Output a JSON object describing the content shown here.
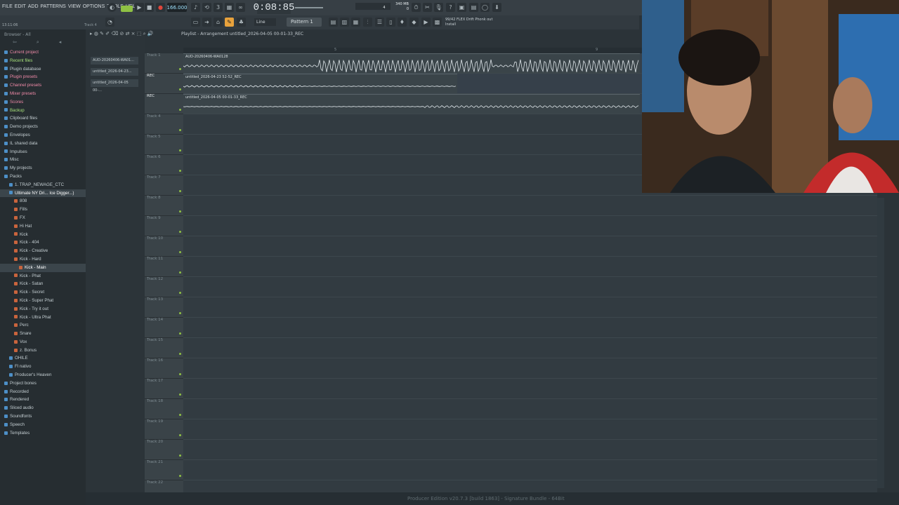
{
  "menu": [
    "FILE",
    "EDIT",
    "ADD",
    "PATTERNS",
    "VIEW",
    "OPTIONS",
    "TOOLS",
    "HELP"
  ],
  "transport": {
    "tempo": "166.000",
    "time": "0:08:85",
    "cpu_line1": "340 MB",
    "cpu_line2": "0",
    "num_a": "4"
  },
  "hint_left": "13:11:06",
  "hint_track": "Track 4",
  "toolbar2": {
    "snap": "Line",
    "pattern": "Pattern 1",
    "plugin_line1": "99/42  FLEX  Drift Phonk out",
    "plugin_line2": "Install"
  },
  "browser": {
    "header": "Browser - All",
    "items": [
      {
        "label": "Current project",
        "style": "pink",
        "indent": 1
      },
      {
        "label": "Recent files",
        "style": "green",
        "indent": 1
      },
      {
        "label": "Plugin database",
        "style": "",
        "indent": 1
      },
      {
        "label": "Plugin presets",
        "style": "pink",
        "indent": 1
      },
      {
        "label": "Channel presets",
        "style": "pink",
        "indent": 1
      },
      {
        "label": "Mixer presets",
        "style": "pink",
        "indent": 1
      },
      {
        "label": "Scores",
        "style": "pink",
        "indent": 1
      },
      {
        "label": "Backup",
        "style": "green",
        "indent": 1
      },
      {
        "label": "Clipboard files",
        "style": "",
        "indent": 1
      },
      {
        "label": "Demo projects",
        "style": "",
        "indent": 1
      },
      {
        "label": "Envelopes",
        "style": "",
        "indent": 1
      },
      {
        "label": "IL shared data",
        "style": "",
        "indent": 1
      },
      {
        "label": "Impulses",
        "style": "",
        "indent": 1
      },
      {
        "label": "Misc",
        "style": "",
        "indent": 1
      },
      {
        "label": "My projects",
        "style": "",
        "indent": 1
      },
      {
        "label": "Packs",
        "style": "",
        "indent": 1
      },
      {
        "label": "1. TRAP_NEWAGE_CTC",
        "style": "",
        "indent": 2
      },
      {
        "label": "Ultimate NY Dri... Ice Digger...)",
        "style": "sel",
        "indent": 2
      },
      {
        "label": "808",
        "style": "",
        "indent": 3
      },
      {
        "label": "Fills",
        "style": "",
        "indent": 3
      },
      {
        "label": "FX",
        "style": "",
        "indent": 3
      },
      {
        "label": "Hi Hat",
        "style": "",
        "indent": 3
      },
      {
        "label": "Kick",
        "style": "",
        "indent": 3
      },
      {
        "label": "Kick - 404",
        "style": "",
        "indent": 3
      },
      {
        "label": "Kick - Creative",
        "style": "",
        "indent": 3
      },
      {
        "label": "Kick - Hard",
        "style": "",
        "indent": 3
      },
      {
        "label": "Kick - Main",
        "style": "sel",
        "indent": 4
      },
      {
        "label": "Kick - Phat",
        "style": "",
        "indent": 3
      },
      {
        "label": "Kick - Satan",
        "style": "",
        "indent": 3
      },
      {
        "label": "Kick - Secret",
        "style": "",
        "indent": 3
      },
      {
        "label": "Kick - Super Phat",
        "style": "",
        "indent": 3
      },
      {
        "label": "Kick - Try it out",
        "style": "",
        "indent": 3
      },
      {
        "label": "Kick - Ultra Phat",
        "style": "",
        "indent": 3
      },
      {
        "label": "Perc",
        "style": "",
        "indent": 3
      },
      {
        "label": "Snare",
        "style": "",
        "indent": 3
      },
      {
        "label": "Vox",
        "style": "",
        "indent": 3
      },
      {
        "label": "z. Bonus",
        "style": "",
        "indent": 3
      },
      {
        "label": "OHILE",
        "style": "",
        "indent": 2
      },
      {
        "label": "Fl nativo",
        "style": "",
        "indent": 2
      },
      {
        "label": "Producer's Heaven",
        "style": "",
        "indent": 2
      },
      {
        "label": "Project bones",
        "style": "",
        "indent": 1
      },
      {
        "label": "Recorded",
        "style": "",
        "indent": 1
      },
      {
        "label": "Rendered",
        "style": "",
        "indent": 1
      },
      {
        "label": "Sliced audio",
        "style": "",
        "indent": 1
      },
      {
        "label": "Soundfonts",
        "style": "",
        "indent": 1
      },
      {
        "label": "Speech",
        "style": "",
        "indent": 1
      },
      {
        "label": "Templates",
        "style": "",
        "indent": 1
      }
    ]
  },
  "playlist": {
    "title": "Playlist - Arrangement  untitled_2026-04-05 00-01-33_REC",
    "ruler_marks": [
      "5",
      "9"
    ],
    "pickers": [
      "AUD-20260406-WA01...",
      "untitled_2026-04-23...",
      "untitled_2026-04-05 00-..."
    ],
    "tracks": [
      {
        "label": "Track 1",
        "rec": ""
      },
      {
        "label": "",
        "rec": "REC"
      },
      {
        "label": "",
        "rec": "REC"
      },
      {
        "label": "Track 4",
        "rec": ""
      },
      {
        "label": "Track 5",
        "rec": ""
      },
      {
        "label": "Track 6",
        "rec": ""
      },
      {
        "label": "Track 7",
        "rec": ""
      },
      {
        "label": "Track 8",
        "rec": ""
      },
      {
        "label": "Track 9",
        "rec": ""
      },
      {
        "label": "Track 10",
        "rec": ""
      },
      {
        "label": "Track 11",
        "rec": ""
      },
      {
        "label": "Track 12",
        "rec": ""
      },
      {
        "label": "Track 13",
        "rec": ""
      },
      {
        "label": "Track 14",
        "rec": ""
      },
      {
        "label": "Track 15",
        "rec": ""
      },
      {
        "label": "Track 16",
        "rec": ""
      },
      {
        "label": "Track 17",
        "rec": ""
      },
      {
        "label": "Track 18",
        "rec": ""
      },
      {
        "label": "Track 19",
        "rec": ""
      },
      {
        "label": "Track 20",
        "rec": ""
      },
      {
        "label": "Track 21",
        "rec": ""
      },
      {
        "label": "Track 22",
        "rec": ""
      }
    ],
    "clips": [
      {
        "label": "AUD-20260406-WA0128",
        "track": 0
      },
      {
        "label": "untitled_2026-04-23 52-52_REC",
        "track": 1
      },
      {
        "label": "untitled_2026-04-05 00-01-33_REC",
        "track": 2
      }
    ]
  },
  "status": "Producer Edition v20.7.3 [build 1863] - Signature Bundle - 64Bit",
  "colors": {
    "accent_green": "#8fc144",
    "accent_red": "#e0463c",
    "tempo_text": "#9fe3ff"
  }
}
